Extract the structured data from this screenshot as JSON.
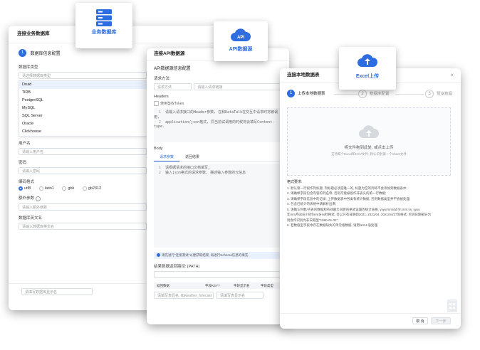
{
  "win1": {
    "title": "连接业务数据库",
    "step_num": "1",
    "step_label": "数据库信息配置",
    "db_type_label": "数据库类型",
    "db_type_placeholder": "请选择数据库类型",
    "db_options": [
      "Druid",
      "TiDB",
      "PostgreSQL",
      "MySQL",
      "SQL Server",
      "Oracle",
      "Clickhouse"
    ],
    "user_label": "用户名",
    "user_placeholder": "请输入用户名",
    "pwd_label": "密码",
    "pwd_placeholder": "请输入密码",
    "encoding_label": "编码格式",
    "encodings": [
      "utf8",
      "latin1",
      "gbk",
      "gb2312"
    ],
    "extra_label": "额外参数",
    "extra_placeholder": "请输入额外参数",
    "dbname_label": "数据库英文名",
    "dbname_placeholder": "请输入数据库英文名",
    "bottom_placeholder": "请填写数据库显示名"
  },
  "badge1": {
    "caption": "业务数据库"
  },
  "win2": {
    "title": "连接API数据源",
    "section": "API数据源信息配置",
    "method_label": "请求方法",
    "method_placeholder": "请求方法",
    "url_placeholder": "请输入请求链接",
    "headers_label": "Headers",
    "token_label": "使用鉴权Token",
    "header_lines": [
      "请输入请求接口的Header参数, 在和DataTalk在交互中请求时将被调用,",
      "application/json格式, 同当前试调用的时候将会填写Content-type."
    ],
    "body_label": "Body",
    "tab_request": "请求参数",
    "tab_result": "返回结果",
    "body_lines": [
      "请根据请求的接口文档填写,",
      "输入json格式的请求参数, 描述输入参数的元信息"
    ],
    "tip": "请先进行\"连接测试\"以便获取结果, 再进行Schema信息的填充.",
    "path_label": "结果数据返回路径: [PATH]",
    "col_headers": [
      "返回数据",
      "字段KEY?",
      "字段显示名",
      "字段类型"
    ],
    "row_placeholder1": "请填写表显名, 如weather_forecast",
    "row_placeholder2": "请填写表显示名"
  },
  "badge2": {
    "caption": "API数据源",
    "icon_text": "API"
  },
  "win3": {
    "title": "连接本地数据表",
    "steps": [
      "上传本地数据表",
      "数据库配置",
      "预览数据"
    ],
    "step_nums": [
      "1",
      "2",
      "3"
    ],
    "upload_text": "将文件拖到此处, 或点击上传",
    "upload_hint": "支持每个Excel和CSV文件, 默认识别第一个sheet文件",
    "format_title": "格式要求:",
    "format_lines": [
      "1. 默认第一行视作列标题, 列标题必须是唯一的, 标题为空的列将不会添加到数据表中;",
      "2. 请确保字段包含内容的列名称, 否则可能被视作非表头的第一行数据;",
      "3. 请确保字段信息中的记录, 上传数据表中各类有统计数据, 否则数据类型并不会被处理;",
      "4. 包含已统计的表格中请解析出来;",
      "5. 请确认列数/子表的数据和有效最大间距的格式设置的统计表格, yyyy/mm/dd hh:mm:ss, yyyy",
      "   年mm月dd日 hh时mm分ss秒格式, 可以只有日期如2021, 2021/04, 2021/04/27等格式, 否则日期部分为",
      "   则会作识别为非日期型\"1990-01-01\";",
      "6. 若数值型字段中存在数据缺失的单元格数据, 请用NULL值处理."
    ],
    "cancel_label": "取 消",
    "next_label": "下一步"
  },
  "badge3": {
    "caption": "Excel上传"
  },
  "colors": {
    "accent": "#2d6de0"
  }
}
